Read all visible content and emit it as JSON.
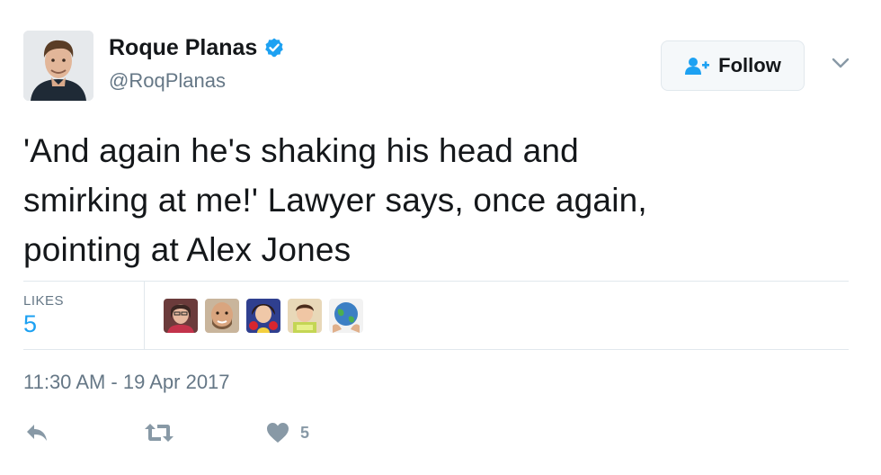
{
  "user": {
    "name": "Roque Planas",
    "handle": "@RoqPlanas",
    "verified": true,
    "verified_color": "#1da1f2"
  },
  "follow_button": {
    "label": "Follow",
    "icon": "follow-person-plus-icon"
  },
  "menu": {
    "icon": "chevron-down-icon"
  },
  "tweet": {
    "text_lines": [
      "'And again he's shaking his head and",
      "smirking at me!' Lawyer says, once again,",
      "pointing at Alex Jones"
    ]
  },
  "stats": {
    "likes_label": "LIKES",
    "likes_count": "5",
    "likers": [
      "liker-avatar-1",
      "liker-avatar-2",
      "liker-avatar-3",
      "liker-avatar-4",
      "liker-avatar-5"
    ]
  },
  "timestamp": "11:30 AM - 19 Apr 2017",
  "actions": {
    "reply_icon": "reply-icon",
    "retweet_icon": "retweet-icon",
    "like_icon": "heart-icon",
    "like_count": "5"
  },
  "colors": {
    "text": "#14171a",
    "secondary": "#657786",
    "accent": "#1da1f2",
    "action_gray": "#8899a6",
    "divider": "#e1e8ed"
  }
}
